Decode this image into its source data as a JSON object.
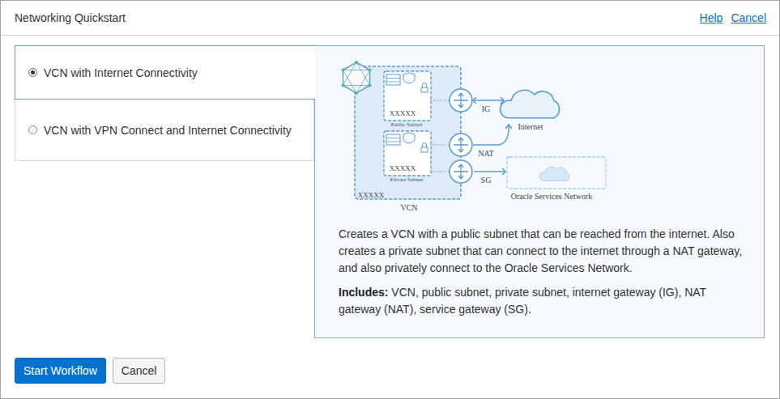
{
  "dialog": {
    "title": "Networking Quickstart",
    "links": [
      "Help",
      "Cancel"
    ]
  },
  "options": [
    {
      "label": "VCN with Internet Connectivity",
      "selected": true
    },
    {
      "label": "VCN with VPN Connect and Internet Connectivity",
      "selected": false
    }
  ],
  "diagram": {
    "vcn_label": "VCN",
    "vcn_cidr": "XXXXX",
    "subnets": [
      {
        "name": "Public Subnet",
        "cidr": "XXXXX"
      },
      {
        "name": "Private Subnet",
        "cidr": "XXXXX"
      }
    ],
    "gateways": [
      "IG",
      "NAT",
      "SG"
    ],
    "internet": "Internet",
    "services": "Oracle Services Network"
  },
  "description": "Creates a VCN with a public subnet that can be reached from the internet. Also creates a private subnet that can connect to the internet through a NAT gateway, and also privately connect to the Oracle Services Network.",
  "includes": {
    "label": "Includes:",
    "text": "VCN, public subnet, private subnet, internet gateway (IG), NAT gateway (NAT), service gateway (SG)."
  },
  "buttons": [
    {
      "label": "Start Workflow",
      "primary": true
    },
    {
      "label": "Cancel",
      "primary": false
    }
  ]
}
